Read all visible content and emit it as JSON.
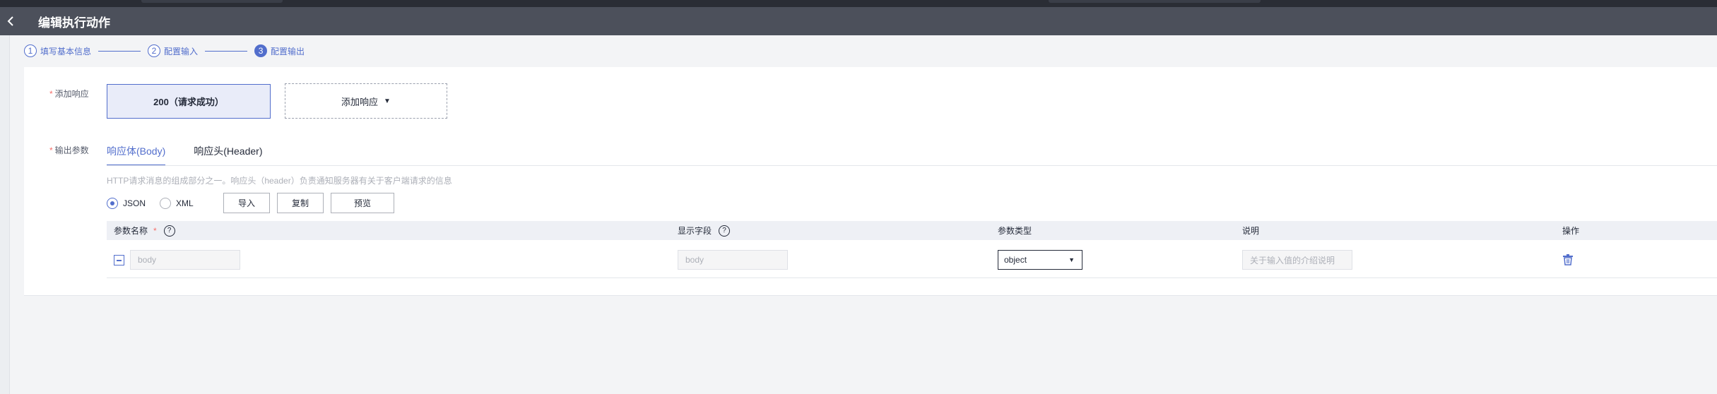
{
  "header": {
    "title": "编辑执行动作",
    "back_icon": "chevron-left-icon"
  },
  "steps": [
    {
      "num": "1",
      "label": "填写基本信息"
    },
    {
      "num": "2",
      "label": "配置输入"
    },
    {
      "num": "3",
      "label": "配置输出",
      "active": true
    }
  ],
  "form": {
    "add_response_label": "添加响应",
    "output_params_label": "输出参数",
    "required_mark": "*"
  },
  "responses": {
    "current": "200（请求成功）",
    "add_button": "添加响应",
    "caret": "▼"
  },
  "tabs": [
    {
      "label": "响应体(Body)",
      "active": true
    },
    {
      "label": "响应头(Header)"
    }
  ],
  "hint": "HTTP请求消息的组成部分之一。响应头（header）负责通知服务器有关于客户端请求的信息",
  "format_options": [
    {
      "label": "JSON",
      "checked": true
    },
    {
      "label": "XML",
      "checked": false
    }
  ],
  "buttons": {
    "import": "导入",
    "copy": "复制",
    "preview": "预览"
  },
  "table": {
    "headers": {
      "name": "参数名称",
      "display": "显示字段",
      "type": "参数类型",
      "desc": "说明",
      "action": "操作"
    },
    "help_mark": "?",
    "rows": [
      {
        "name": "body",
        "display": "body",
        "type": "object",
        "desc_placeholder": "关于输入值的介绍说明"
      }
    ]
  },
  "colors": {
    "accent": "#526ecc",
    "required": "#f66f6a",
    "header_bg": "#4c505b"
  }
}
